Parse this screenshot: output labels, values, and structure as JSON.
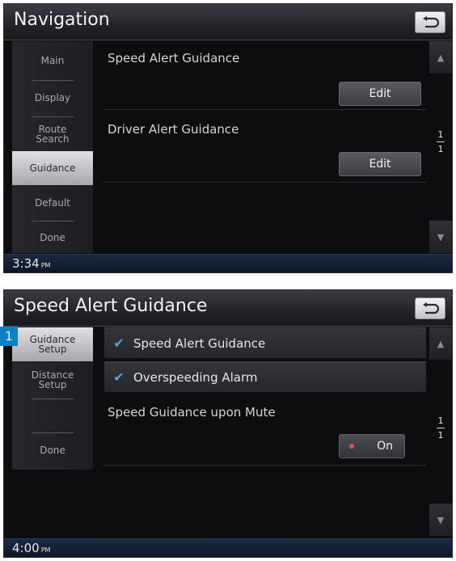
{
  "screen1": {
    "title": "Navigation",
    "sidebar": [
      "Main",
      "Display",
      "Route\nSearch",
      "Guidance",
      "Default",
      "Done"
    ],
    "active_index": 3,
    "rows": [
      {
        "label": "Speed Alert Guidance",
        "button": "Edit"
      },
      {
        "label": "Driver Alert Guidance",
        "button": "Edit"
      }
    ],
    "page": {
      "current": "1",
      "total": "1"
    },
    "time": "3:34",
    "ampm": "PM"
  },
  "screen2": {
    "title": "Speed Alert Guidance",
    "sidebar": [
      "Guidance\nSetup",
      "Distance\nSetup",
      "",
      "Done"
    ],
    "active_index": 0,
    "checks": [
      {
        "label": "Speed Alert Guidance",
        "checked": true
      },
      {
        "label": "Overspeeding Alarm",
        "checked": true
      }
    ],
    "mute_label": "Speed Guidance upon Mute",
    "mute_value": "On",
    "page": {
      "current": "1",
      "total": "1"
    },
    "time": "4:00",
    "ampm": "PM"
  },
  "callout": "1",
  "icons": {
    "back": "back-arrow-icon",
    "up": "scroll-up-icon",
    "down": "scroll-down-icon",
    "check": "checkmark-icon"
  },
  "colors": {
    "accent": "#0a80c8",
    "check": "#5aa0e6"
  }
}
